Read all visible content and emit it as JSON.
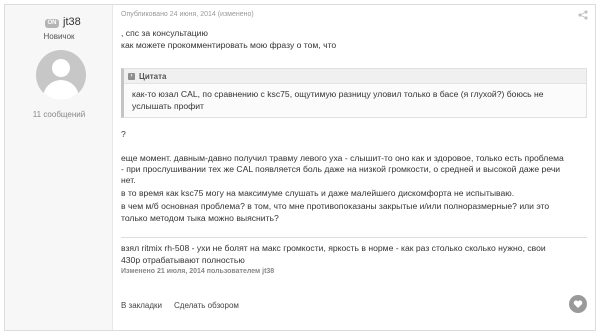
{
  "author": {
    "badge": "ON",
    "username": "jt38",
    "rank": "Новичок",
    "post_count": "11 сообщений"
  },
  "post": {
    "meta": "Опубликовано 24 июня, 2014 (изменено)",
    "intro_lines": [
      ", спс за консультацию",
      "как можете прокомментировать мою фразу о том, что"
    ],
    "quote": {
      "title": "Цитата",
      "lines": [
        "как-то юзал CAL, по сравнению с ksc75, ощутимую разницу уловил только в басе (я глухой?) боюсь не",
        "услышать профит"
      ]
    },
    "question_mark": "?",
    "body_lines": [
      "еще момент. давным-давно получил травму левого уха - слышит-то оно как и здоровое, только есть проблема",
      "- при прослушивании тех же CAL появляется боль даже на низкой громкости, о средней и высокой даже речи",
      "нет.",
      "в то время как ksc75 могу на максимуме слушать и даже малейшего дискомфорта не испытываю.",
      "в чем м/б основная проблема? в том, что мне противопоказаны закрытые и/или полноразмерные? или это",
      "только методом тыка можно выяснить?"
    ],
    "signature_lines": [
      "взял ritmix rh-508 - ухи не болят на макс громкости, яркость в норме - как раз столько сколько нужно, свои",
      "430p отрабатывают полностью"
    ],
    "edited_prefix": "Изменено 21 июля, 2014 пользователем",
    "edited_user": "jt38"
  },
  "footer": {
    "bookmark_label": "В закладки",
    "review_label": "Сделать обзором"
  }
}
